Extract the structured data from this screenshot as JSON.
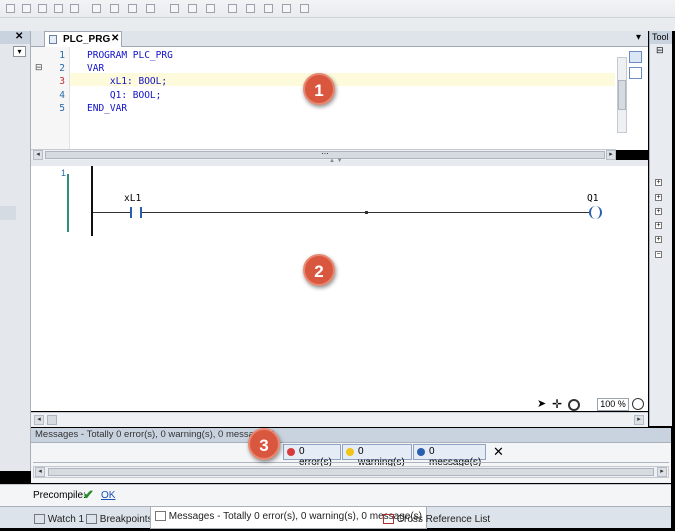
{
  "editor": {
    "tab_label": "PLC_PRG",
    "tab_close": "✕",
    "dropdown": "▾",
    "declaration_lines": [
      {
        "num": "1",
        "code": "PROGRAM PLC_PRG"
      },
      {
        "num": "2",
        "code": "VAR"
      },
      {
        "num": "3",
        "code": "    xL1: BOOL;"
      },
      {
        "num": "4",
        "code": "    Q1: BOOL;"
      },
      {
        "num": "5",
        "code": "END_VAR"
      }
    ],
    "collapse_marker": "⊟",
    "splitter_grip": "⋯",
    "splitter_arrows": "▲ ▼"
  },
  "ladder": {
    "network_number": "1",
    "contact_label": "xL1",
    "coil_label": "Q1",
    "zoom": "100 %"
  },
  "left_panel": {
    "close": "✕",
    "dropdown": "▾"
  },
  "right_panel": {
    "title": "Tool",
    "collapse": "⊟",
    "plus": "+",
    "minus": "−"
  },
  "messages": {
    "header": "Messages - Totally 0 error(s), 0 warning(s), 0 message(s)",
    "errors": "0 error(s)",
    "warnings": "0 warning(s)",
    "infos": "0 message(s)",
    "clear": "✕"
  },
  "precompile": {
    "label": "Precompile:",
    "status": "OK"
  },
  "bottom_tabs": [
    {
      "label": "Watch 1"
    },
    {
      "label": "Breakpoints"
    },
    {
      "label": "Messages - Totally 0 error(s), 0 warning(s), 0 message(s)"
    },
    {
      "label": "Cross Reference List"
    }
  ],
  "callouts": {
    "one": "1",
    "two": "2",
    "three": "3"
  },
  "colors": {
    "badge": "#d9573f",
    "highlight_line": "#fdfbdc",
    "keyword": "#1010c8",
    "ok_green": "#2a8a2a"
  }
}
